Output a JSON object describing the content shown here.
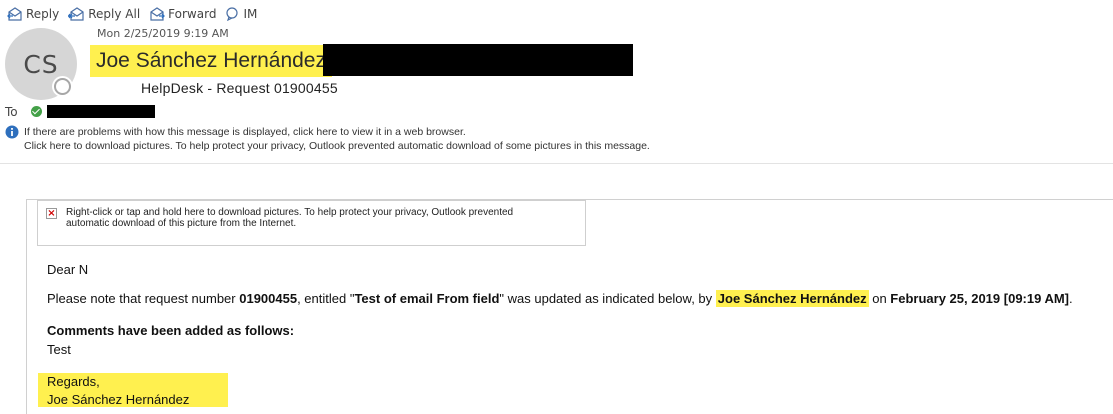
{
  "toolbar": {
    "reply": "Reply",
    "reply_all": "Reply All",
    "forward": "Forward",
    "im": "IM"
  },
  "message": {
    "sent": "Mon 2/25/2019 9:19 AM",
    "avatar_initials": "CS",
    "sender_name": "Joe Sánchez Hernández",
    "subject": "HelpDesk - Request 01900455",
    "to_label": "To"
  },
  "infobar": {
    "line1": "If there are problems with how this message is displayed, click here to view it in a web browser.",
    "line2": "Click here to download pictures. To help protect your privacy, Outlook prevented automatic download of some pictures in this message."
  },
  "image_placeholder": {
    "text": "Right-click or tap and hold here to download pictures. To help protect your privacy, Outlook prevented automatic download of this picture from the Internet."
  },
  "body": {
    "greeting": "Dear N",
    "p_part1": "Please note that request number ",
    "request_number": "01900455",
    "p_part2": ", entitled \"",
    "request_title": "Test of email From field",
    "p_part3": "\" was updated as indicated below, by ",
    "updated_by": "Joe Sánchez Hernández",
    "p_part4": " on ",
    "updated_on": "February 25, 2019 [09:19 AM]",
    "p_part5": ".",
    "comments_heading": "Comments have been added as follows:",
    "comments_value": "Test",
    "regards": "Regards,",
    "signature": "Joe Sánchez Hernández"
  },
  "colors": {
    "highlight": "#fff04f",
    "presence_green": "#43a047",
    "info_blue": "#2e6fbd",
    "avatar_bg": "#d6d6d6"
  }
}
